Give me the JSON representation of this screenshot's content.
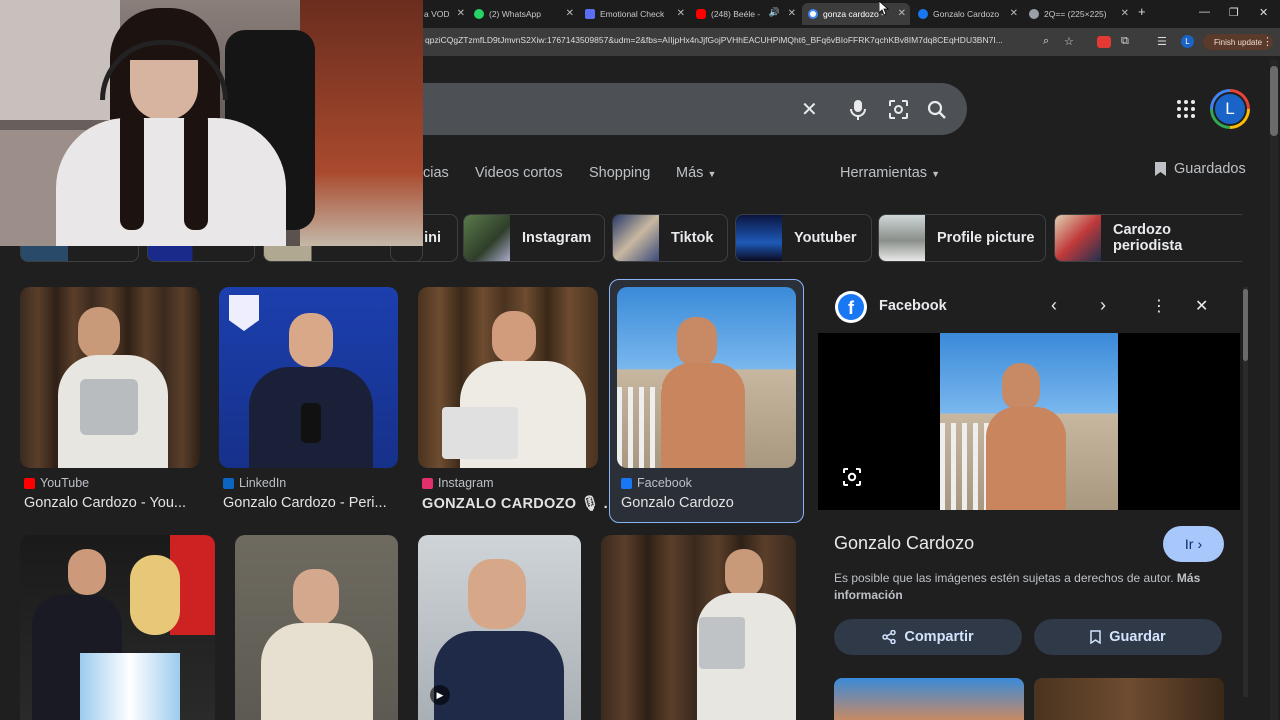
{
  "browser": {
    "tabs": [
      {
        "label": "a VOD",
        "color": "#7b5cd6",
        "active": false
      },
      {
        "label": "(2) WhatsApp",
        "color": "#25d366",
        "active": false
      },
      {
        "label": "Emotional Check",
        "color": "#5b6ef5",
        "active": false
      },
      {
        "label": "(248) Beéle -",
        "color": "#ff0000",
        "active": false
      },
      {
        "label": "gonza cardozo -",
        "color": "#ffffff",
        "active": true
      },
      {
        "label": "Gonzalo Cardozo",
        "color": "#1877f2",
        "active": false
      },
      {
        "label": "2Q== (225×225)",
        "color": "#9aa0a6",
        "active": false
      }
    ],
    "new_tab": "+",
    "url": "qpziCQgZTzmfLD9tJmvnS2Xiw:1767143509857&udm=2&fbs=AIIjpHx4nJjfGojPVHhEACUHPiMQht6_BFq6vBIoFFRK7qchKBv8IM7dq8CEqHDU3BN7I...",
    "finish_update": "Finish update",
    "profile_letter": "L"
  },
  "search": {
    "nav_tabs": [
      "cias",
      "Videos cortos",
      "Shopping",
      "Más",
      "Herramientas"
    ],
    "saved_label": "Guardados",
    "account_letter": "L"
  },
  "chips": [
    {
      "label": "ini"
    },
    {
      "label": "Instagram"
    },
    {
      "label": "Tiktok"
    },
    {
      "label": "Youtuber"
    },
    {
      "label": "Profile picture"
    },
    {
      "label": "Cardozo periodista"
    }
  ],
  "results": [
    {
      "source": "YouTube",
      "title": "Gonzalo Cardozo - You...",
      "source_color": "#ff0000"
    },
    {
      "source": "LinkedIn",
      "title": "Gonzalo Cardozo - Peri...",
      "source_color": "#0a66c2"
    },
    {
      "source": "Instagram",
      "title": "GONZALO CARDOZO 🎙 ...",
      "source_color": "#e1306c"
    },
    {
      "source": "Facebook",
      "title": "Gonzalo Cardozo",
      "source_color": "#1877f2"
    }
  ],
  "panel": {
    "source": "Facebook",
    "title": "Gonzalo Cardozo",
    "go_button": "Ir",
    "copyright": "Es posible que las imágenes estén sujetas a derechos de autor.",
    "more_info": "Más información",
    "share_button": "Compartir",
    "save_button": "Guardar"
  }
}
